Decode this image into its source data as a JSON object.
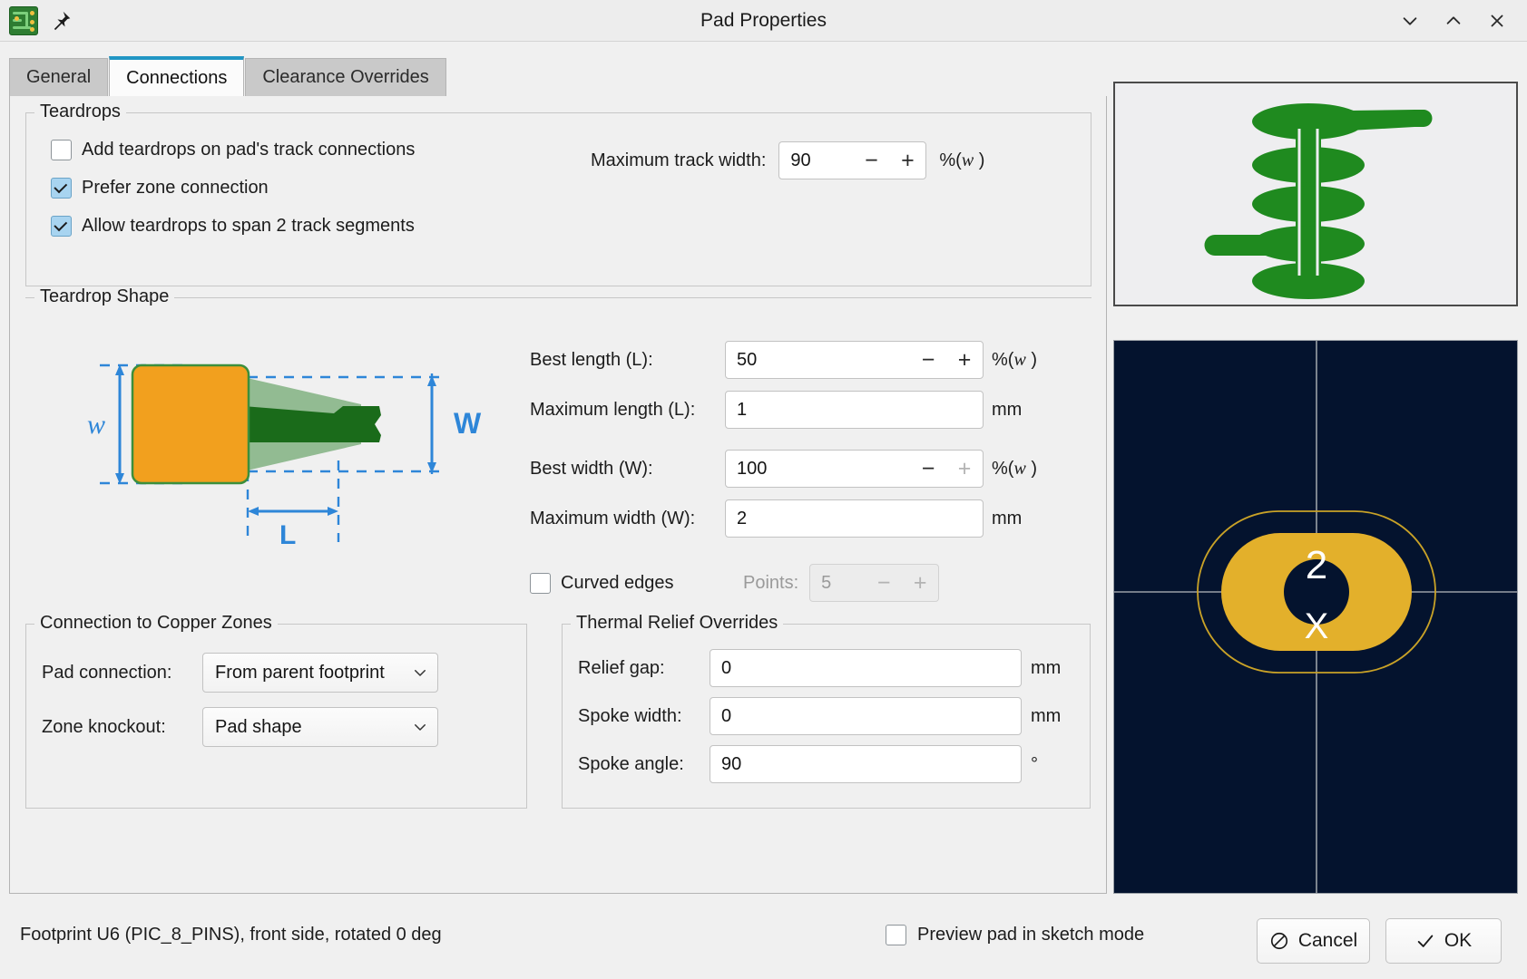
{
  "window": {
    "title": "Pad Properties",
    "app_icon": "kicad-pcb-icon",
    "pin_icon": "pin-icon",
    "minimize_icon": "chevron-down-icon",
    "maximize_icon": "chevron-up-icon",
    "close_icon": "close-icon"
  },
  "tabs": [
    {
      "label": "General",
      "active": false
    },
    {
      "label": "Connections",
      "active": true
    },
    {
      "label": "Clearance Overrides",
      "active": false
    }
  ],
  "teardrops": {
    "group_label": "Teardrops",
    "checkboxes": [
      {
        "label": "Add teardrops on pad's track connections",
        "checked": false
      },
      {
        "label": "Prefer zone connection",
        "checked": true
      },
      {
        "label": "Allow teardrops to span 2 track segments",
        "checked": true
      }
    ],
    "max_track_width": {
      "label": "Maximum track width:",
      "value": "90",
      "unit": "%(w )",
      "minus": "−",
      "plus": "+",
      "minus_enabled": true,
      "plus_enabled": true
    }
  },
  "teardrop_shape": {
    "group_label": "Teardrop Shape",
    "diagram": {
      "label_w_small": "w",
      "label_w_big": "W",
      "label_l": "L",
      "pad_color": "#f2a01e",
      "teardrop_color": "#1f7a1f",
      "dim_color": "#2e86d8"
    },
    "fields": [
      {
        "label": "Best length (L):",
        "value": "50",
        "unit": "%(w )",
        "spinner": true,
        "minus_enabled": true,
        "plus_enabled": true
      },
      {
        "label": "Maximum length (L):",
        "value": "1",
        "unit": "mm",
        "spinner": false
      },
      {
        "label": "Best width (W):",
        "value": "100",
        "unit": "%(w )",
        "spinner": true,
        "minus_enabled": true,
        "plus_enabled": false
      },
      {
        "label": "Maximum width (W):",
        "value": "2",
        "unit": "mm",
        "spinner": false
      }
    ],
    "curved_edges": {
      "label": "Curved edges",
      "checked": false
    },
    "points": {
      "label": "Points:",
      "value": "5",
      "enabled": false,
      "minus": "−",
      "plus": "+"
    }
  },
  "copper_zones": {
    "group_label": "Connection to Copper Zones",
    "rows": [
      {
        "label": "Pad connection:",
        "value": "From parent footprint"
      },
      {
        "label": "Zone knockout:",
        "value": "Pad shape"
      }
    ]
  },
  "thermal_relief": {
    "group_label": "Thermal Relief Overrides",
    "rows": [
      {
        "label": "Relief gap:",
        "value": "0",
        "unit": "mm"
      },
      {
        "label": "Spoke width:",
        "value": "0",
        "unit": "mm"
      },
      {
        "label": "Spoke angle:",
        "value": "90",
        "unit": "°"
      }
    ]
  },
  "preview": {
    "top_name": "teardrop-preview",
    "bottom_name": "pad-3d-preview",
    "pad_number": "2",
    "pad_net": "X",
    "pad_fill_color": "#e3b02b",
    "pad_outline_color": "#c9a227",
    "canvas_bg": "#04132e",
    "crosshair_color": "#9aa0a6",
    "teardrop_green": "#1f8a1f"
  },
  "footer": {
    "status": "Footprint U6 (PIC_8_PINS), front side, rotated 0 deg",
    "sketch_checkbox": {
      "label": "Preview pad in sketch mode",
      "checked": false
    },
    "cancel_label": "Cancel",
    "ok_label": "OK",
    "cancel_icon": "no-entry-icon",
    "ok_icon": "check-icon"
  }
}
